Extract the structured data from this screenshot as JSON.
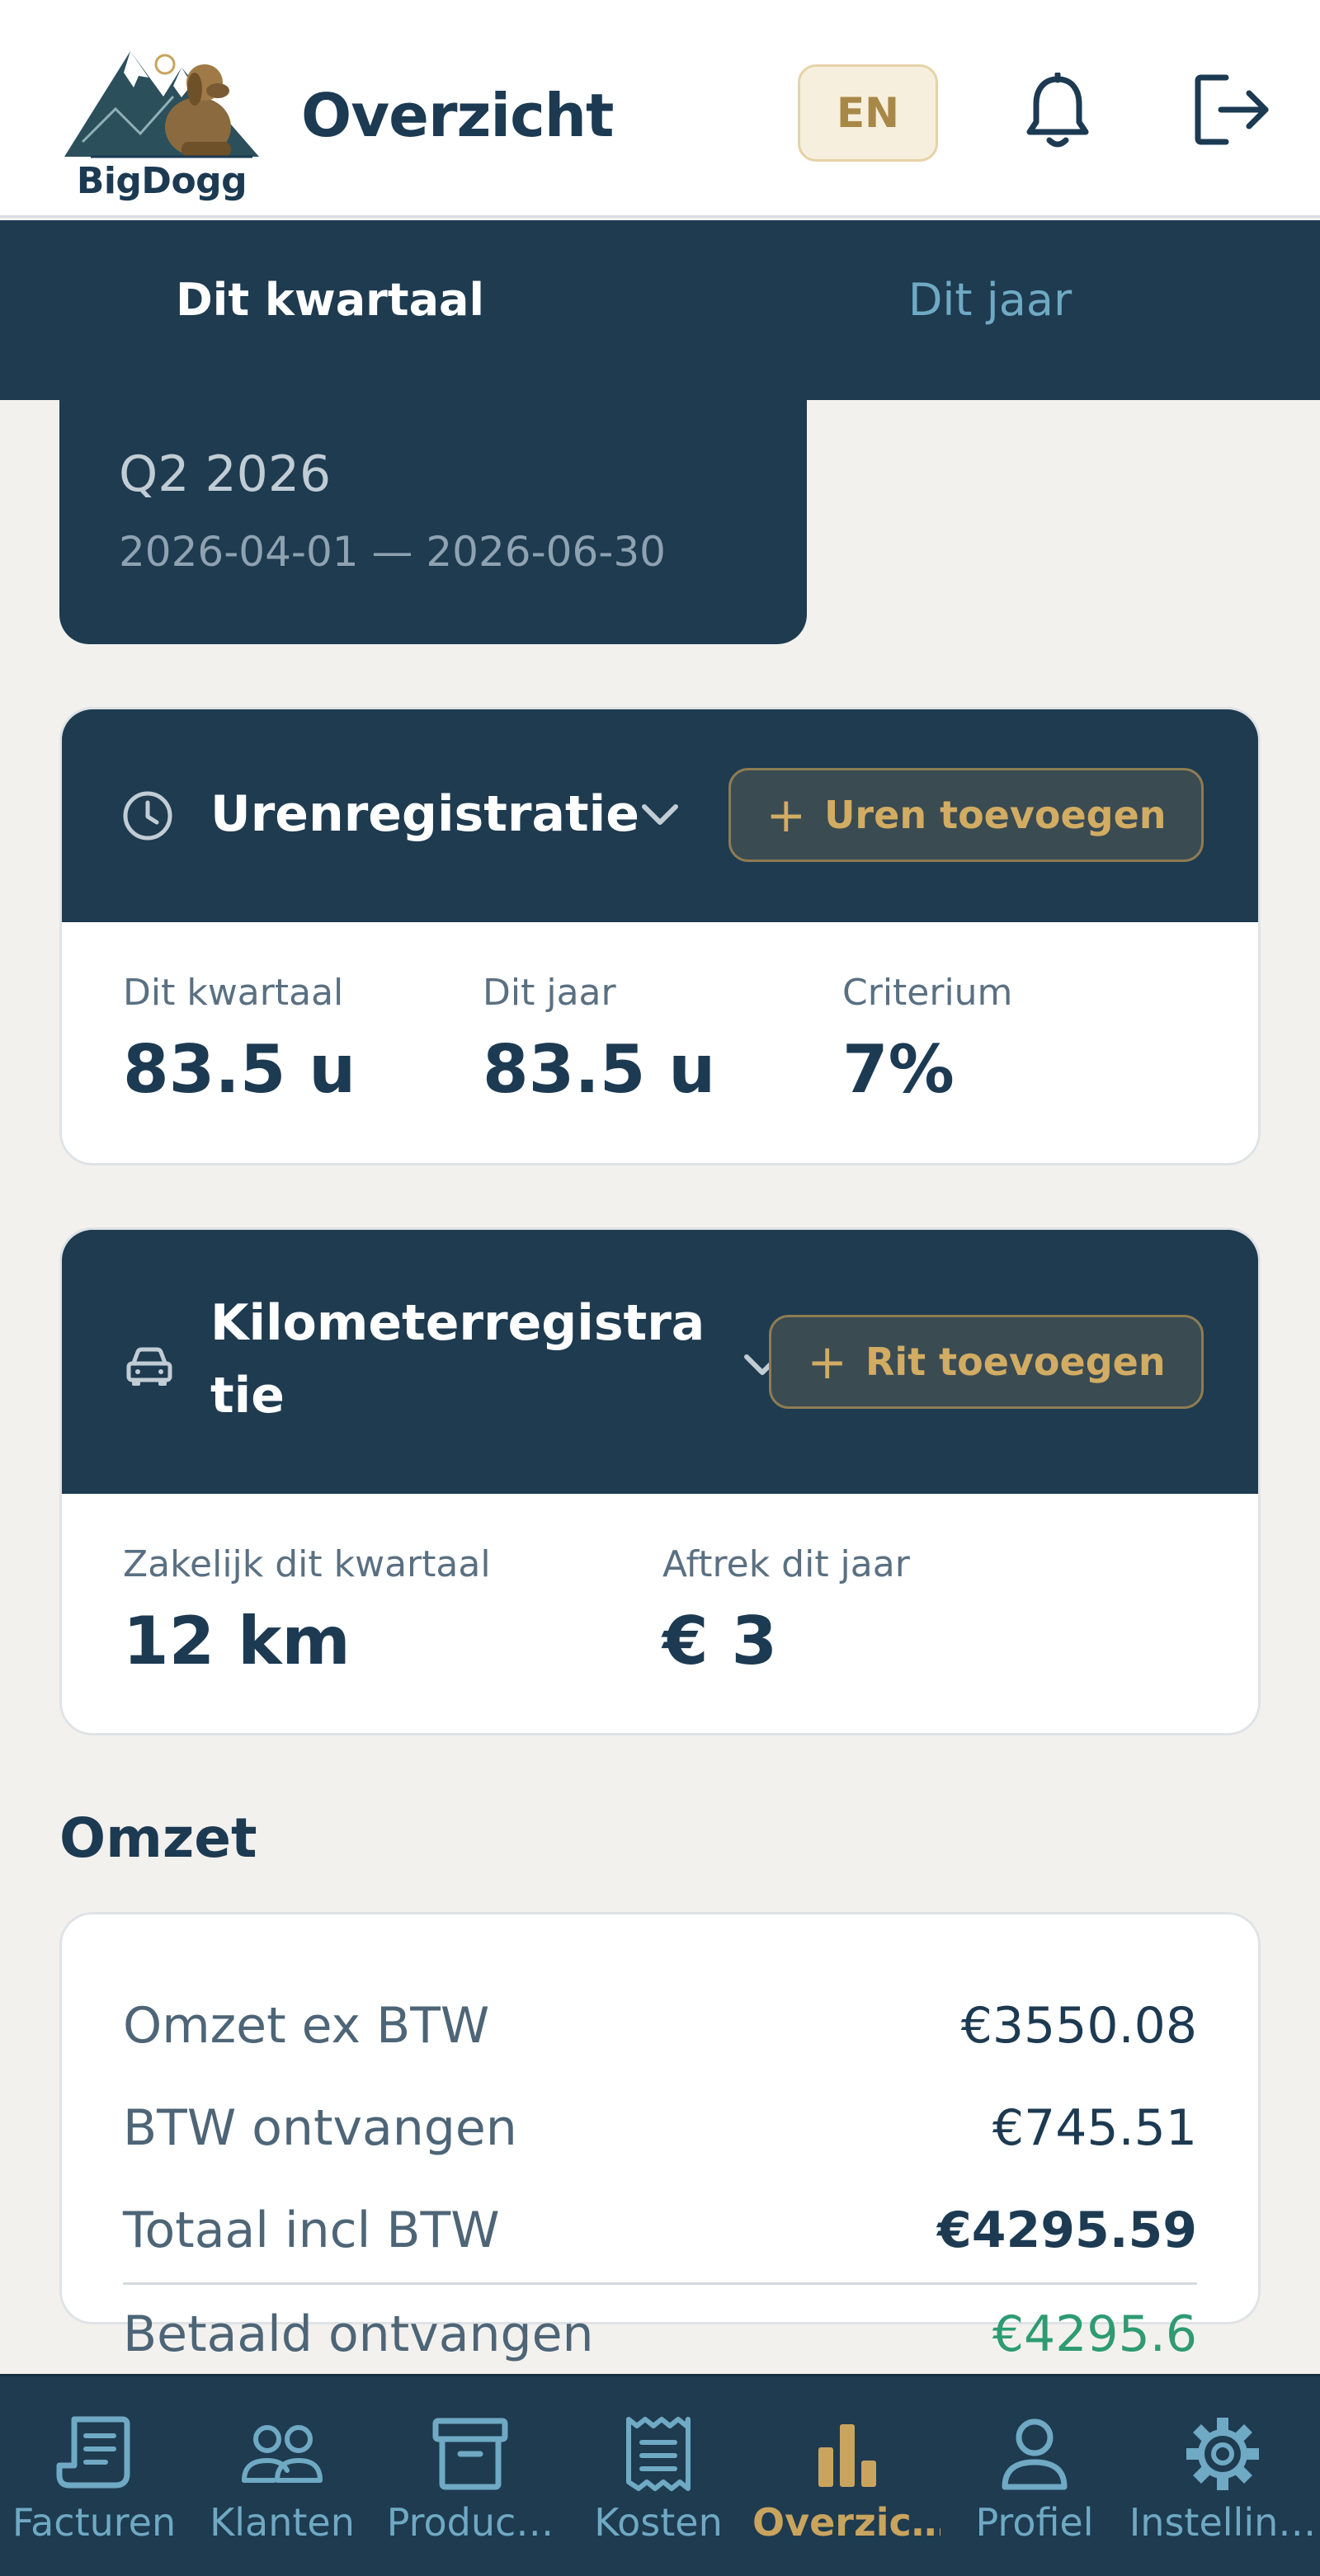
{
  "header": {
    "logo_text": "BigDogg",
    "title": "Overzicht",
    "lang_button": "EN",
    "icons": [
      "bell-icon",
      "logout-icon"
    ]
  },
  "tabs": [
    {
      "label": "Dit kwartaal",
      "active": true
    },
    {
      "label": "Dit jaar",
      "active": false
    }
  ],
  "period": {
    "quarter": "Q2 2026",
    "range": "2026-04-01 — 2026-06-30"
  },
  "hours": {
    "title": "Urenregistratie",
    "icon": "clock-icon",
    "add_label": "Uren toevoegen",
    "stats": [
      {
        "label": "Dit kwartaal",
        "value": "83.5 u"
      },
      {
        "label": "Dit jaar",
        "value": "83.5 u"
      },
      {
        "label": "Criterium",
        "value": "7%"
      }
    ]
  },
  "mileage": {
    "title_line1": "Kilometerregistra",
    "title_line2": "tie",
    "icon": "car-icon",
    "add_label": "Rit toevoegen",
    "stats": [
      {
        "label": "Zakelijk dit kwartaal",
        "value": "12 km"
      },
      {
        "label": "Aftrek dit jaar",
        "value": "€ 3"
      }
    ]
  },
  "revenue": {
    "title": "Omzet",
    "rows": [
      {
        "label": "Omzet ex BTW",
        "value": "€3550.08"
      },
      {
        "label": "BTW ontvangen",
        "value": "€745.51"
      },
      {
        "label": "Totaal incl BTW",
        "value": "€4295.59"
      },
      {
        "label": "Betaald ontvangen",
        "value": "€4295.6"
      }
    ]
  },
  "nav": [
    {
      "label": "Facturen",
      "icon": "invoice-icon"
    },
    {
      "label": "Klanten",
      "icon": "users-icon"
    },
    {
      "label": "Produc…",
      "icon": "archive-icon"
    },
    {
      "label": "Kosten",
      "icon": "receipt-icon"
    },
    {
      "label": "Overzic…",
      "icon": "chart-icon",
      "active": true
    },
    {
      "label": "Profiel",
      "icon": "user-icon"
    },
    {
      "label": "Instellin…",
      "icon": "settings-icon"
    }
  ],
  "colors": {
    "navy": "#1e3b50",
    "gold": "#c9a45e",
    "muted_blue": "#6fa9c4",
    "green": "#2e9b72",
    "background": "#f3f1ee"
  }
}
